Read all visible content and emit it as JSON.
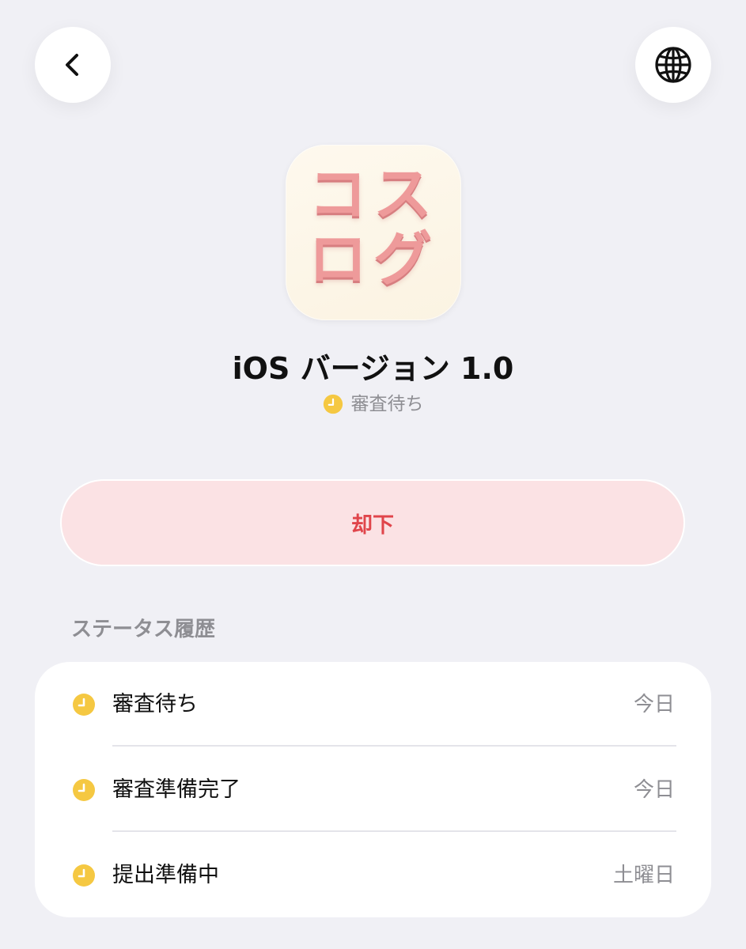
{
  "nav": {
    "back_icon": "chevron-left-icon",
    "globe_icon": "globe-icon"
  },
  "app": {
    "icon_text": "コス\nログ",
    "icon_color": "#EE9A9A",
    "icon_bg": "#FEF9EE"
  },
  "version": {
    "title": "iOS バージョン 1.0",
    "status_label": "審査待ち",
    "status_icon": "clock-icon",
    "status_color": "#F5C842"
  },
  "actions": {
    "reject_label": "却下",
    "reject_color": "#E0454B",
    "reject_bg": "#FBE2E4"
  },
  "history": {
    "section_title": "ステータス履歴",
    "items": [
      {
        "label": "審査待ち",
        "date": "今日",
        "icon": "clock-icon"
      },
      {
        "label": "審査準備完了",
        "date": "今日",
        "icon": "clock-icon"
      },
      {
        "label": "提出準備中",
        "date": "土曜日",
        "icon": "clock-icon"
      }
    ]
  }
}
